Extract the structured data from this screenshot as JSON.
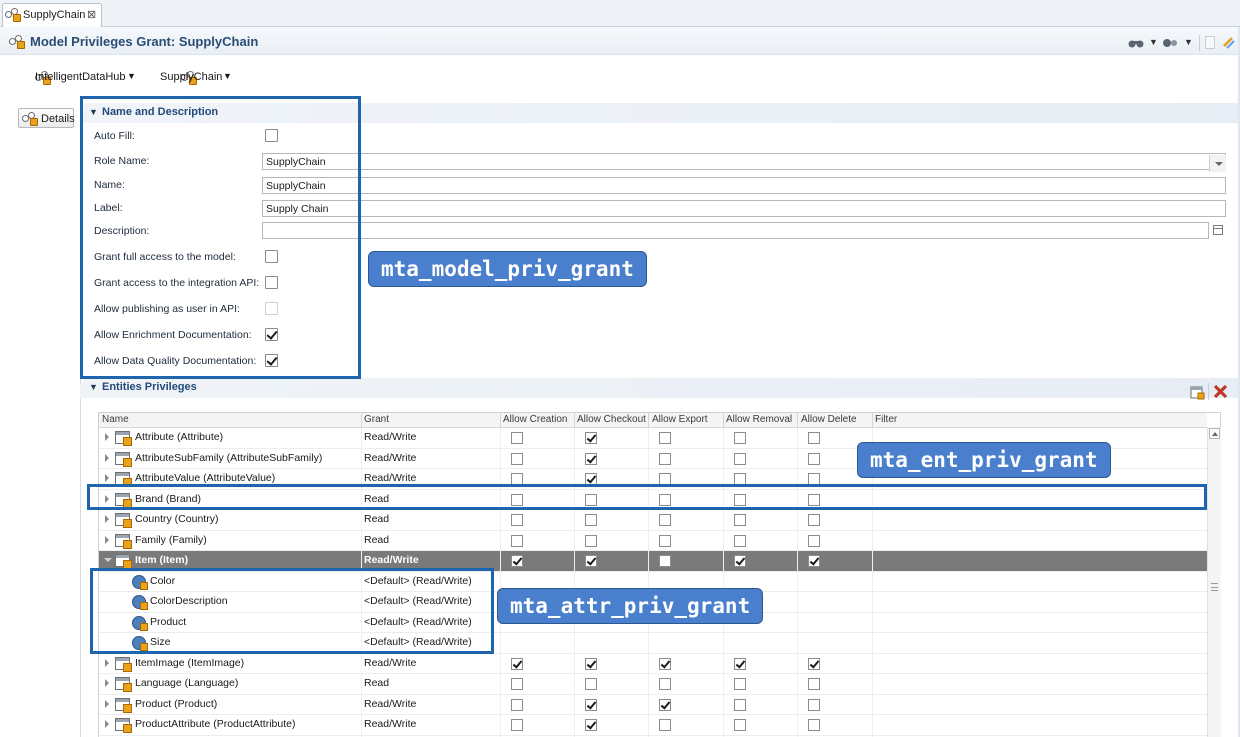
{
  "tab": {
    "label": "SupplyChain",
    "close": "⊠"
  },
  "header": {
    "title": "Model Privileges Grant: SupplyChain"
  },
  "breadcrumb": {
    "items": [
      "IntelligentDataHub",
      "SupplyChain"
    ]
  },
  "side": {
    "details_label": "Details"
  },
  "name_section": {
    "title": "Name and Description",
    "fields": {
      "auto_fill": {
        "label": "Auto Fill:",
        "checked": false
      },
      "role_name": {
        "label": "Role Name:",
        "value": "SupplyChain"
      },
      "name": {
        "label": "Name:",
        "value": "SupplyChain"
      },
      "label": {
        "label": "Label:",
        "value": "Supply Chain"
      },
      "description": {
        "label": "Description:",
        "value": ""
      },
      "grant_full": {
        "label": "Grant full access to the model:",
        "checked": false
      },
      "grant_api": {
        "label": "Grant access to the integration API:",
        "checked": false
      },
      "allow_publishing": {
        "label": "Allow publishing as user in API:",
        "checked": false,
        "disabled": true
      },
      "allow_enrichment": {
        "label": "Allow Enrichment Documentation:",
        "checked": true
      },
      "allow_dq": {
        "label": "Allow Data Quality Documentation:",
        "checked": true
      }
    }
  },
  "annotations": {
    "model": "mta_model_priv_grant",
    "entity": "mta_ent_priv_grant",
    "attr": "mta_attr_priv_grant"
  },
  "entities_section": {
    "title": "Entities Privileges",
    "columns": [
      "Name",
      "Grant",
      "Allow Creation",
      "Allow Checkout",
      "Allow Export",
      "Allow Removal",
      "Allow Delete",
      "Filter"
    ],
    "rows": [
      {
        "name": "Attribute (Attribute)",
        "grant": "Read/Write",
        "flags": [
          false,
          true,
          false,
          false,
          false
        ],
        "kind": "entity"
      },
      {
        "name": "AttributeSubFamily (AttributeSubFamily)",
        "grant": "Read/Write",
        "flags": [
          false,
          true,
          false,
          false,
          false
        ],
        "kind": "entity"
      },
      {
        "name": "AttributeValue (AttributeValue)",
        "grant": "Read/Write",
        "flags": [
          false,
          true,
          false,
          false,
          false
        ],
        "kind": "entity"
      },
      {
        "name": "Brand (Brand)",
        "grant": "Read",
        "flags": [
          false,
          false,
          false,
          false,
          false
        ],
        "kind": "entity"
      },
      {
        "name": "Country (Country)",
        "grant": "Read",
        "flags": [
          false,
          false,
          false,
          false,
          false
        ],
        "kind": "entity"
      },
      {
        "name": "Family (Family)",
        "grant": "Read",
        "flags": [
          false,
          false,
          false,
          false,
          false
        ],
        "kind": "entity"
      },
      {
        "name": "Item (Item)",
        "grant": "Read/Write",
        "flags": [
          true,
          true,
          false,
          true,
          true
        ],
        "kind": "entity",
        "selected": true,
        "expanded": true
      },
      {
        "name": "Color",
        "grant": "<Default> (Read/Write)",
        "kind": "attribute"
      },
      {
        "name": "ColorDescription",
        "grant": "<Default> (Read/Write)",
        "kind": "attribute"
      },
      {
        "name": "Product",
        "grant": "<Default> (Read/Write)",
        "kind": "attribute"
      },
      {
        "name": "Size",
        "grant": "<Default> (Read/Write)",
        "kind": "attribute"
      },
      {
        "name": "ItemImage (ItemImage)",
        "grant": "Read/Write",
        "flags": [
          true,
          true,
          true,
          true,
          true
        ],
        "kind": "entity"
      },
      {
        "name": "Language (Language)",
        "grant": "Read",
        "flags": [
          false,
          false,
          false,
          false,
          false
        ],
        "kind": "entity"
      },
      {
        "name": "Product (Product)",
        "grant": "Read/Write",
        "flags": [
          false,
          true,
          true,
          false,
          false
        ],
        "kind": "entity"
      },
      {
        "name": "ProductAttribute (ProductAttribute)",
        "grant": "Read/Write",
        "flags": [
          false,
          true,
          false,
          false,
          false
        ],
        "kind": "entity"
      }
    ]
  },
  "colors": {
    "accent": "#2b4d74",
    "annotation_box": "#1f65ad",
    "callout_bg": "#4a7fcd",
    "selected_row": "#7a7a7a",
    "delete_red": "#c0392b"
  }
}
